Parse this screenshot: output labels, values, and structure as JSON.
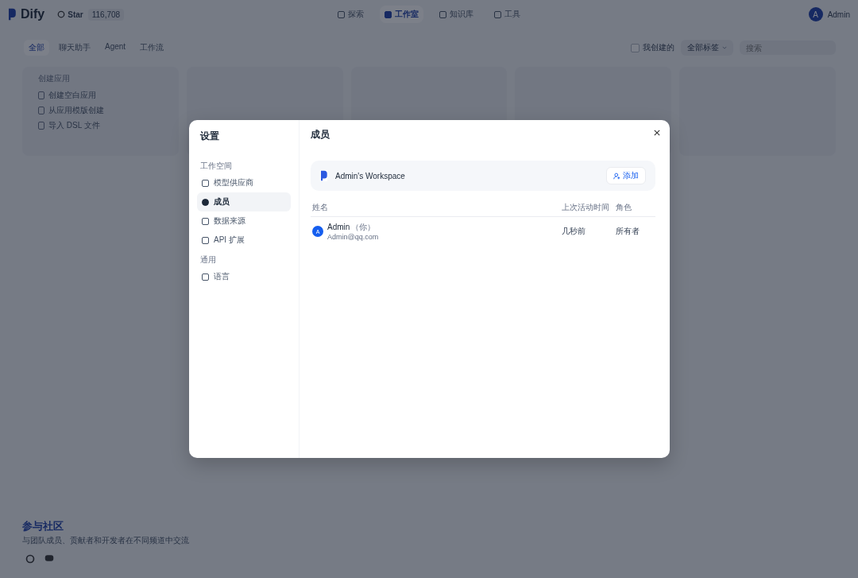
{
  "header": {
    "brand": "Dify",
    "github_label": "Star",
    "github_count": "116,708",
    "nav": [
      {
        "label": "探索",
        "selected": false
      },
      {
        "label": "工作室",
        "selected": true
      },
      {
        "label": "知识库",
        "selected": false
      },
      {
        "label": "工具",
        "selected": false
      }
    ],
    "user": {
      "initial": "A",
      "name": "Admin"
    }
  },
  "filters": {
    "tabs": [
      {
        "label": "全部",
        "selected": true
      },
      {
        "label": "聊天助手",
        "selected": false
      },
      {
        "label": "Agent",
        "selected": false
      },
      {
        "label": "工作流",
        "selected": false
      }
    ],
    "mine": {
      "label": "我创建的",
      "checked": false
    },
    "tag_select": "全部标签",
    "search": {
      "placeholder": "搜索"
    }
  },
  "create_card": {
    "title": "创建应用",
    "items": [
      "创建空白应用",
      "从应用模版创建",
      "导入 DSL 文件"
    ]
  },
  "community": {
    "title": "参与社区",
    "text": "与团队成员、贡献者和开发者在不同频道中交流"
  },
  "modal": {
    "title": "设置",
    "sections": [
      {
        "title": "工作空间",
        "items": [
          {
            "label": "模型供应商",
            "selected": false
          },
          {
            "label": "成员",
            "selected": true
          },
          {
            "label": "数据来源",
            "selected": false
          },
          {
            "label": "API 扩展",
            "selected": false
          }
        ]
      },
      {
        "title": "通用",
        "items": [
          {
            "label": "语言",
            "selected": false
          }
        ]
      }
    ],
    "content_title": "成员",
    "workspace": "Admin's Workspace",
    "add_button": "添加",
    "columns": [
      "姓名",
      "上次活动时间",
      "角色"
    ],
    "rows": [
      {
        "avatar": "A",
        "name": "Admin",
        "you": "（你）",
        "email": "Admin@qq.com",
        "last_active": "几秒前",
        "role": "所有者"
      }
    ]
  }
}
